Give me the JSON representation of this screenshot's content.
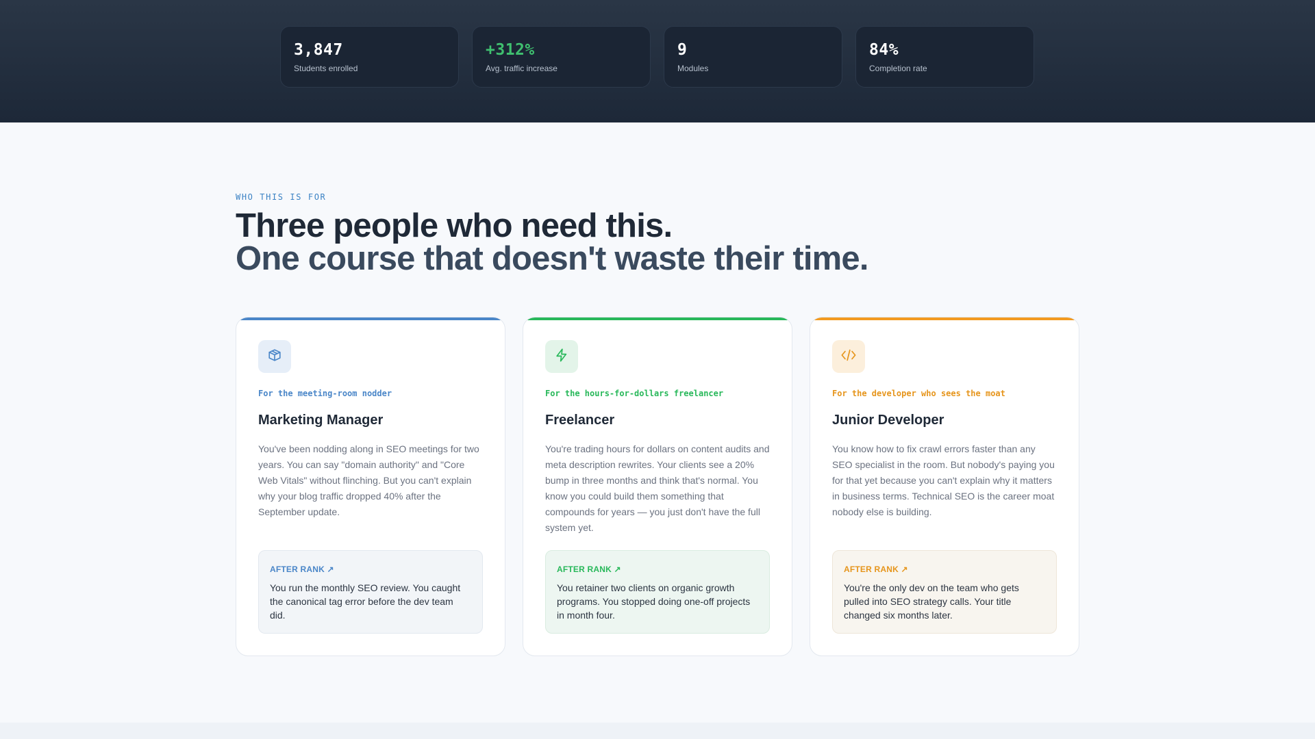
{
  "stats": [
    {
      "value": "3,847",
      "label": "Students enrolled"
    },
    {
      "value": "+312%",
      "label": "Avg. traffic increase"
    },
    {
      "value": "9",
      "label": "Modules"
    },
    {
      "value": "84%",
      "label": "Completion rate"
    }
  ],
  "audience": {
    "eyebrow": "WHO THIS IS FOR",
    "headline_line1": "Three people who need this.",
    "headline_line2": "One course that doesn't waste their time.",
    "cards": [
      {
        "icon": "cube-icon",
        "accent": "#4a86c8",
        "tagline": "For the meeting-room nodder",
        "title": "Marketing Manager",
        "body": "You've been nodding along in SEO meetings for two years. You can say \"domain authority\" and \"Core Web Vitals\" without flinching. But you can't explain why your blog traffic dropped 40% after the September update.",
        "after_label": "AFTER RANK ↗",
        "after_text": "You run the monthly SEO review. You caught the canonical tag error before the dev team did."
      },
      {
        "icon": "lightning-icon",
        "accent": "#28b85a",
        "tagline": "For the hours-for-dollars freelancer",
        "title": "Freelancer",
        "body": "You're trading hours for dollars on content audits and meta description rewrites. Your clients see a 20% bump in three months and think that's normal. You know you could build them something that compounds for years — you just don't have the full system yet.",
        "after_label": "AFTER RANK ↗",
        "after_text": "You retainer two clients on organic growth programs. You stopped doing one-off projects in month four."
      },
      {
        "icon": "code-icon",
        "accent": "#e6951c",
        "tagline": "For the developer who sees the moat",
        "title": "Junior Developer",
        "body": "You know how to fix crawl errors faster than any SEO specialist in the room. But nobody's paying you for that yet because you can't explain why it matters in business terms. Technical SEO is the career moat nobody else is building.",
        "after_label": "AFTER RANK ↗",
        "after_text": "You're the only dev on the team who gets pulled into SEO strategy calls. Your title changed six months later."
      }
    ]
  }
}
